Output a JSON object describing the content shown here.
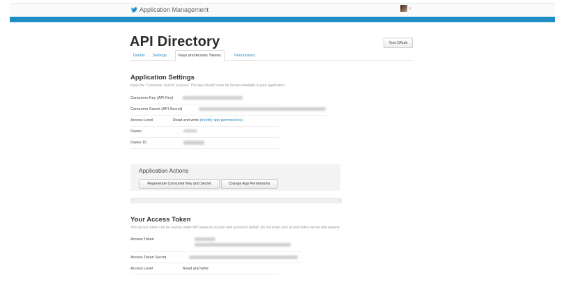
{
  "header": {
    "brand": "Application Management",
    "brand_icon": "twitter-bird-icon",
    "brand_color": "#1d8dc3"
  },
  "page": {
    "title": "API Directory",
    "test_oauth": "Test OAuth"
  },
  "tabs": [
    "Details",
    "Settings",
    "Keys and Access Tokens",
    "Permissions"
  ],
  "settings": {
    "heading": "Application Settings",
    "hint": "Keep the \"Consumer Secret\" a secret. This key should never be human-readable in your application.",
    "rows": [
      {
        "label": "Consumer Key (API Key)"
      },
      {
        "label": "Consumer Secret (API Secret)"
      },
      {
        "label": "Access Level",
        "value": "Read and write",
        "link": "(modify app permissions)"
      },
      {
        "label": "Owner"
      },
      {
        "label": "Owner ID"
      }
    ]
  },
  "actions": {
    "heading": "Application Actions",
    "regenerate": "Regenerate Consumer Key and Secret",
    "change_permissions": "Change App Permissions"
  },
  "token": {
    "heading": "Your Access Token",
    "hint": "This access token can be used to make API requests on your own account's behalf. Do not share your access token secret with anyone.",
    "rows": [
      {
        "label": "Access Token"
      },
      {
        "label": "Access Token Secret"
      },
      {
        "label": "Access Level",
        "value": "Read and write"
      }
    ]
  }
}
